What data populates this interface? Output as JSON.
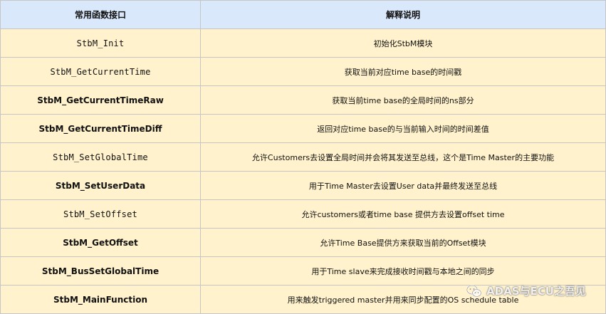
{
  "table": {
    "headers": {
      "function": "常用函数接口",
      "description": "解释说明"
    },
    "rows": [
      {
        "function": "StbM_Init",
        "mono": true,
        "description": "初始化StbM模块"
      },
      {
        "function": "StbM_GetCurrentTime",
        "mono": true,
        "description": "获取当前对应time base的时间戳"
      },
      {
        "function": "StbM_GetCurrentTimeRaw",
        "mono": false,
        "description": "获取当前time base的全局时间的ns部分"
      },
      {
        "function": "StbM_GetCurrentTimeDiff",
        "mono": false,
        "description": "返回对应time base的与当前输入时间的时间差值"
      },
      {
        "function": "StbM_SetGlobalTime",
        "mono": true,
        "description": "允许Customers去设置全局时间并会将其发送至总线，这个是Time Master的主要功能"
      },
      {
        "function": "StbM_SetUserData",
        "mono": false,
        "description": "用于Time Master去设置User data并最终发送至总线"
      },
      {
        "function": "StbM_SetOffset",
        "mono": true,
        "description": "允许customers或者time base 提供方去设置offset time"
      },
      {
        "function": "StbM_GetOffset",
        "mono": false,
        "description": "允许Time Base提供方来获取当前的Offset模块"
      },
      {
        "function": "StbM_BusSetGlobalTime",
        "mono": false,
        "description": "用于Time slave来完成接收时间戳与本地之间的同步"
      },
      {
        "function": "StbM_MainFunction",
        "mono": false,
        "description": "用来触发triggered master并用来同步配置的OS schedule table"
      }
    ]
  },
  "watermark": {
    "icon": "wechat-icon",
    "text": "ADAS与ECU之吾见"
  },
  "colors": {
    "header_bg": "#dae8fc",
    "row_bg": "#fff2cc",
    "border": "#c6c6c6"
  }
}
